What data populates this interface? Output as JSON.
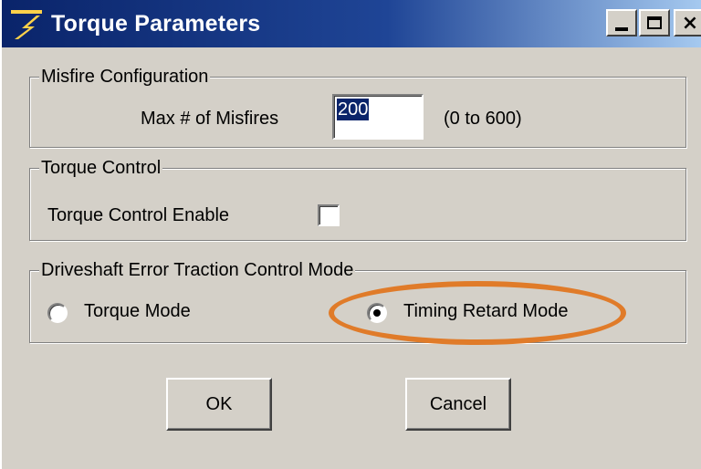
{
  "window": {
    "title": "Torque Parameters",
    "controls": {
      "minimize": "minimize",
      "maximize": "maximize",
      "close": "×"
    }
  },
  "misfire": {
    "group_label": "Misfire Configuration",
    "max_label": "Max # of Misfires",
    "max_value": "200",
    "range": "(0 to 600)"
  },
  "torque_control": {
    "group_label": "Torque Control",
    "enable_label": "Torque Control Enable",
    "enabled": false
  },
  "traction": {
    "group_label": "Driveshaft Error Traction Control Mode",
    "options": [
      {
        "label": "Torque Mode",
        "selected": false
      },
      {
        "label": "Timing Retard Mode",
        "selected": true
      }
    ]
  },
  "buttons": {
    "ok": "OK",
    "cancel": "Cancel"
  },
  "colors": {
    "titlebar_start": "#0a246a",
    "titlebar_end": "#a6caf0",
    "dialog_face": "#d4d0c8",
    "annotation": "#e07b29"
  }
}
